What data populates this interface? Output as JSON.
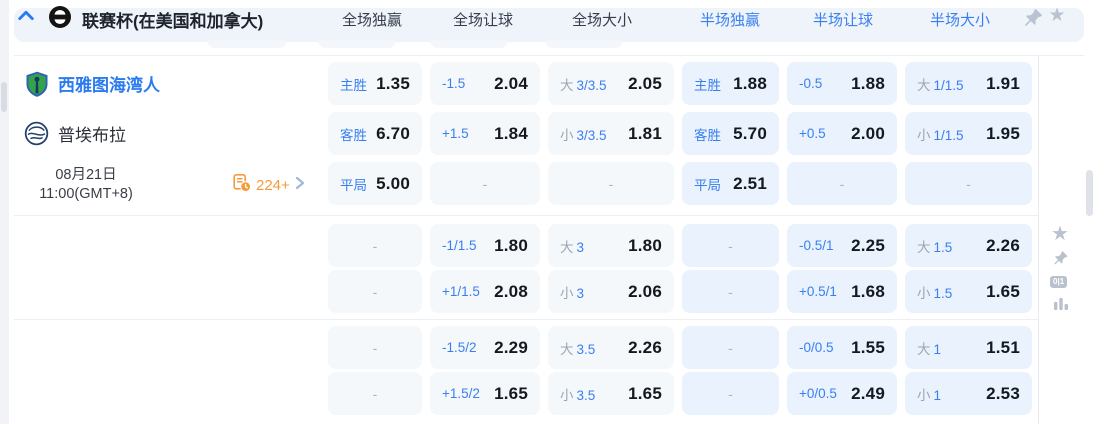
{
  "colors": {
    "accent_blue": "#3A7FF0",
    "link_blue": "#2B7BF0",
    "orange": "#F59B3C",
    "cell_bg_full": "#F5F8FB",
    "cell_bg_half": "#E9F2FD",
    "value_dark": "#14181F"
  },
  "header": {
    "league_title": "联赛杯(在美国和加拿大)",
    "columns": [
      {
        "label": "全场独赢",
        "half": false
      },
      {
        "label": "全场让球",
        "half": false
      },
      {
        "label": "全场大小",
        "half": false
      },
      {
        "label": "半场独赢",
        "half": true
      },
      {
        "label": "半场让球",
        "half": true
      },
      {
        "label": "半场大小",
        "half": true
      }
    ],
    "icons": [
      "chevron-up-icon",
      "league-logo-icon",
      "pin-icon",
      "star-icon"
    ]
  },
  "match": {
    "home_team": "西雅图海湾人",
    "away_team": "普埃布拉",
    "date": "08月21日",
    "time": "11:00(GMT+8)",
    "more_markets": "224+"
  },
  "side_rail": {
    "icons": [
      "star-icon",
      "pin-icon",
      "score-toggle-icon",
      "bar-chart-icon"
    ],
    "score_toggle_text": "0|1"
  },
  "odds_rows": [
    [
      {
        "label": "主胜",
        "value": "1.35"
      },
      {
        "label": "-1.5",
        "value": "2.04"
      },
      {
        "prefix": "大",
        "label": "3/3.5",
        "value": "2.05"
      },
      {
        "label": "主胜",
        "value": "1.88"
      },
      {
        "label": "-0.5",
        "value": "1.88"
      },
      {
        "prefix": "大",
        "label": "1/1.5",
        "value": "1.91"
      }
    ],
    [
      {
        "label": "客胜",
        "value": "6.70"
      },
      {
        "label": "+1.5",
        "value": "1.84"
      },
      {
        "prefix": "小",
        "label": "3/3.5",
        "value": "1.81"
      },
      {
        "label": "客胜",
        "value": "5.70"
      },
      {
        "label": "+0.5",
        "value": "2.00"
      },
      {
        "prefix": "小",
        "label": "1/1.5",
        "value": "1.95"
      }
    ],
    [
      {
        "label": "平局",
        "value": "5.00"
      },
      {
        "dash": true
      },
      {
        "dash": true
      },
      {
        "label": "平局",
        "value": "2.51"
      },
      {
        "dash": true
      },
      {
        "dash": true
      }
    ],
    [
      {
        "dash": true
      },
      {
        "label": "-1/1.5",
        "value": "1.80"
      },
      {
        "prefix": "大",
        "label": "3",
        "value": "1.80"
      },
      {
        "dash": true
      },
      {
        "label": "-0.5/1",
        "value": "2.25"
      },
      {
        "prefix": "大",
        "label": "1.5",
        "value": "2.26"
      }
    ],
    [
      {
        "dash": true
      },
      {
        "label": "+1/1.5",
        "value": "2.08"
      },
      {
        "prefix": "小",
        "label": "3",
        "value": "2.06"
      },
      {
        "dash": true
      },
      {
        "label": "+0.5/1",
        "value": "1.68"
      },
      {
        "prefix": "小",
        "label": "1.5",
        "value": "1.65"
      }
    ],
    [
      {
        "dash": true
      },
      {
        "label": "-1.5/2",
        "value": "2.29"
      },
      {
        "prefix": "大",
        "label": "3.5",
        "value": "2.26"
      },
      {
        "dash": true
      },
      {
        "label": "-0/0.5",
        "value": "1.55"
      },
      {
        "prefix": "大",
        "label": "1",
        "value": "1.51"
      }
    ],
    [
      {
        "dash": true
      },
      {
        "label": "+1.5/2",
        "value": "1.65"
      },
      {
        "prefix": "小",
        "label": "3.5",
        "value": "1.65"
      },
      {
        "dash": true
      },
      {
        "label": "+0/0.5",
        "value": "2.49"
      },
      {
        "prefix": "小",
        "label": "1",
        "value": "2.53"
      }
    ]
  ]
}
